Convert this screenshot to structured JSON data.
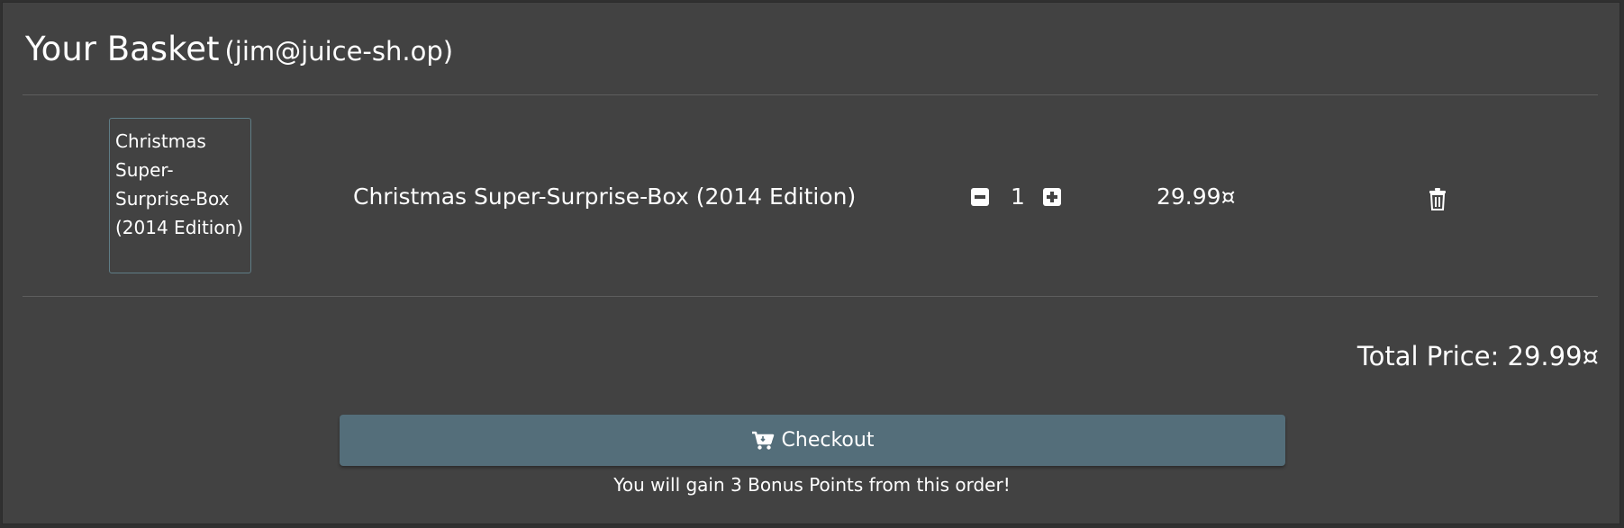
{
  "basket": {
    "title": "Your Basket",
    "email": "(jim@juice-sh.op)"
  },
  "items": [
    {
      "image_alt": "Christmas Super-Surprise-Box (2014 Edition)",
      "name": "Christmas Super-Surprise-Box (2014 Edition)",
      "quantity": "1",
      "price": "29.99¤"
    }
  ],
  "icons": {
    "decrease": "minus-square-icon",
    "increase": "plus-square-icon",
    "delete": "trash-icon",
    "checkout": "cart-arrow-down-icon"
  },
  "summary": {
    "total_price": "Total Price: 29.99¤",
    "checkout_label": "Checkout",
    "bonus_text": "You will gain 3 Bonus Points from this order!"
  },
  "colors": {
    "background": "#303030",
    "card": "#424242",
    "accent": "#546e7a",
    "thumb_border": "#5f7d86"
  }
}
